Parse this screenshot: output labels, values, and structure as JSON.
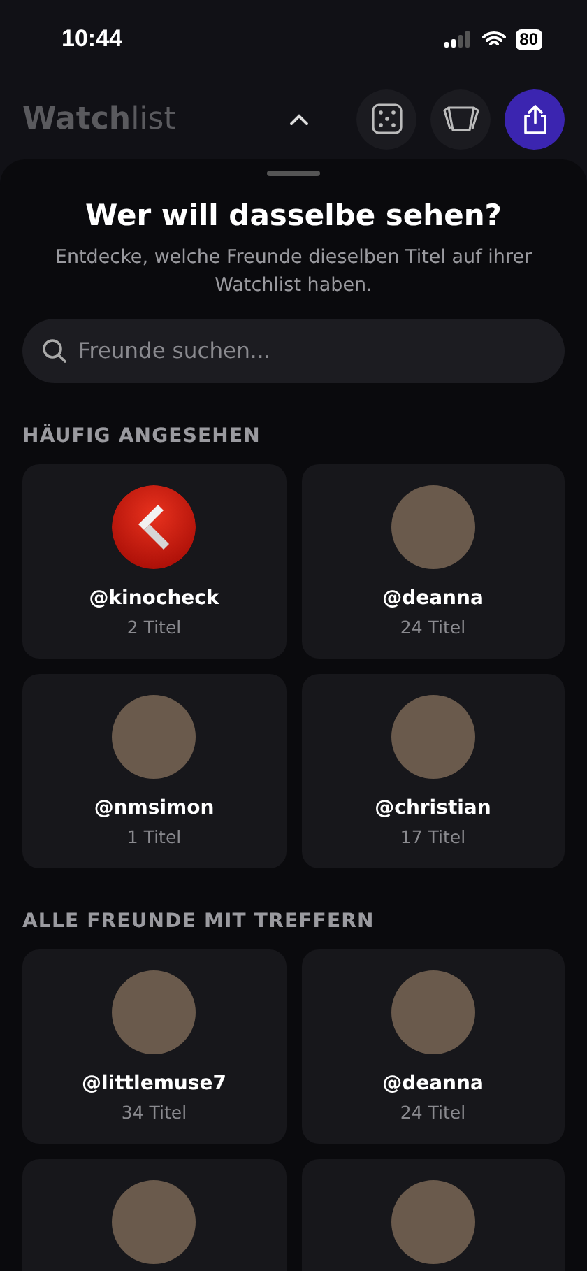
{
  "status_bar": {
    "time": "10:44",
    "battery": "80"
  },
  "header": {
    "title": "**Watch**list"
  },
  "sheet": {
    "title": "Wer will dasselbe sehen?",
    "subtitle": "Entdecke, welche Freunde dieselben Titel auf ihrer Watchlist haben.",
    "search": {
      "placeholder": "Freunde suchen..."
    },
    "sections": [
      {
        "heading": "HÄUFIG ANGESEHEN",
        "friends": [
          {
            "kind": "logo",
            "name": "@kinocheck",
            "count": "2 Titel"
          },
          {
            "kind": "photo",
            "name": "@deanna",
            "count": "24 Titel"
          },
          {
            "kind": "photo",
            "name": "@nmsimon",
            "count": "1 Titel"
          },
          {
            "kind": "photo",
            "name": "@christian",
            "count": "17 Titel"
          }
        ]
      },
      {
        "heading": "ALLE FREUNDE MIT TREFFERN",
        "friends": [
          {
            "kind": "photo",
            "name": "@littlemuse7",
            "count": "34 Titel"
          },
          {
            "kind": "photo",
            "name": "@deanna",
            "count": "24 Titel"
          },
          {
            "kind": "photo"
          },
          {
            "kind": "photo"
          }
        ]
      }
    ]
  }
}
